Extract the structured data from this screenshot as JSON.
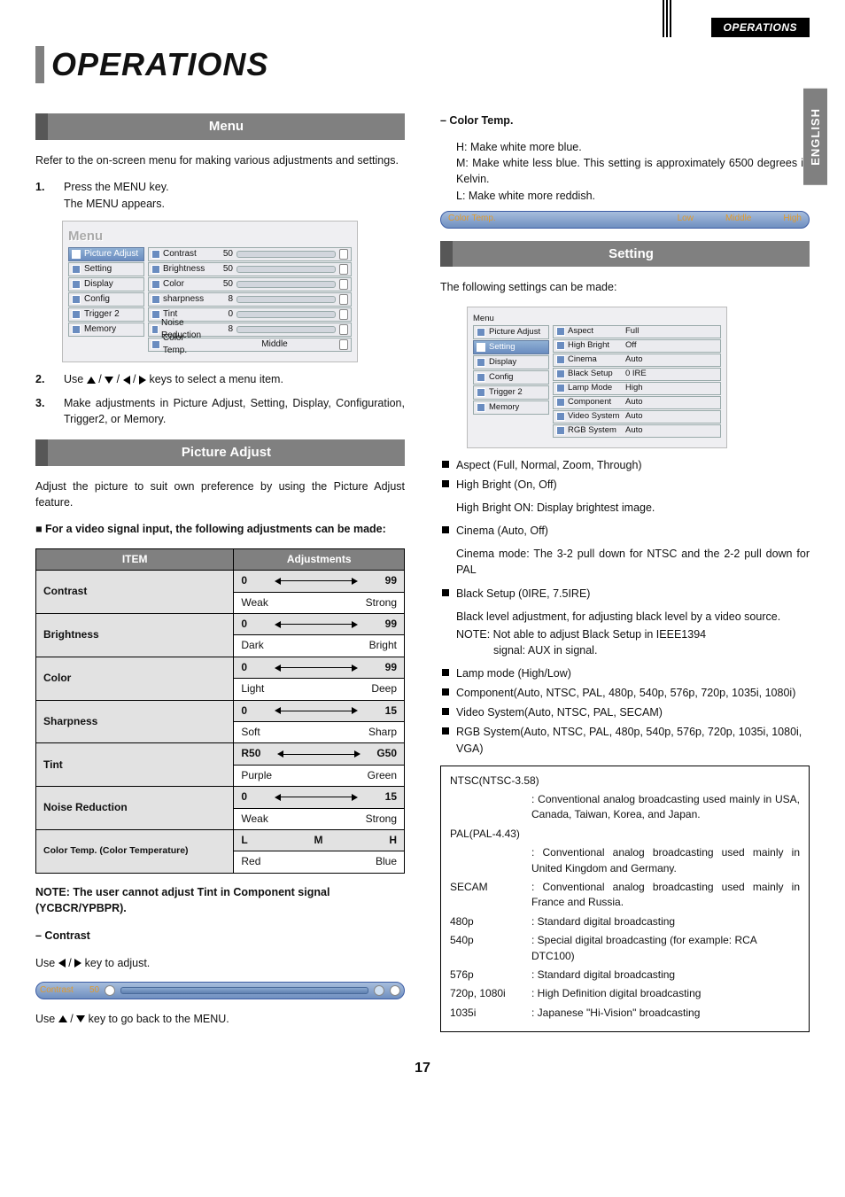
{
  "header": {
    "running_head": "OPERATIONS",
    "side_tab": "ENGLISH"
  },
  "title": "OPERATIONS",
  "left": {
    "menu_heading": "Menu",
    "intro": "Refer to the on-screen menu for making various adjustments and settings.",
    "step1": {
      "num": "1.",
      "text": "Press the MENU key.",
      "sub": "The MENU appears."
    },
    "menu1": {
      "word": "Menu",
      "left": [
        "Picture Adjust",
        "Setting",
        "Display",
        "Config",
        "Trigger 2",
        "Memory"
      ],
      "rows": [
        {
          "label": "Contrast",
          "v": "50",
          "fill": 50
        },
        {
          "label": "Brightness",
          "v": "50",
          "fill": 50
        },
        {
          "label": "Color",
          "v": "50",
          "fill": 50
        },
        {
          "label": "sharpness",
          "v": "8",
          "fill": 53
        },
        {
          "label": "Tint",
          "v": "0",
          "fill": 40
        },
        {
          "label": "Noise Reduction",
          "v": "8",
          "fill": 53
        },
        {
          "label": "Color Temp.",
          "v": "Middle",
          "bar": false
        }
      ]
    },
    "step2": {
      "num": "2.",
      "pre": "Use",
      "post": "keys to select a menu item."
    },
    "step3": {
      "num": "3.",
      "text": "Make adjustments in Picture Adjust, Setting, Display, Configuration, Trigger2, or Memory."
    },
    "pict_heading": "Picture Adjust",
    "pict_intro": "Adjust the picture to suit own preference by using the Picture Adjust feature.",
    "pict_bold": "For a video signal input, the following adjustments can be made:",
    "table": {
      "headers": {
        "item": "ITEM",
        "adj": "Adjustments"
      },
      "rows": [
        {
          "item": "Contrast",
          "lo": "0",
          "hi": "99",
          "llab": "Weak",
          "rlab": "Strong"
        },
        {
          "item": "Brightness",
          "lo": "0",
          "hi": "99",
          "llab": "Dark",
          "rlab": "Bright"
        },
        {
          "item": "Color",
          "lo": "0",
          "hi": "99",
          "llab": "Light",
          "rlab": "Deep"
        },
        {
          "item": "Sharpness",
          "lo": "0",
          "hi": "15",
          "llab": "Soft",
          "rlab": "Sharp"
        },
        {
          "item": "Tint",
          "lo": "R50",
          "hi": "G50",
          "llab": "Purple",
          "rlab": "Green"
        },
        {
          "item": "Noise Reduction",
          "lo": "0",
          "hi": "15",
          "llab": "Weak",
          "rlab": "Strong"
        },
        {
          "item": "Color Temp. (Color Temperature)",
          "ctL": "L",
          "ctM": "M",
          "ctH": "H",
          "llab": "Red",
          "rlab": "Blue"
        }
      ]
    },
    "note": "NOTE: The user cannot adjust Tint in Component signal (YCBCR/YPBPR).",
    "contrast_sub": "– Contrast",
    "contrast_use_pre": "Use",
    "contrast_use_post": "key to adjust.",
    "contrast_bar": {
      "label": "Contrast",
      "val": "50"
    },
    "back_pre": "Use",
    "back_post": "key to go back to the MENU."
  },
  "right": {
    "ct_heading": "– Color Temp.",
    "ct_H": "H:  Make white more blue.",
    "ct_M": "M: Make white less blue. This setting is approximately 6500 degrees in Kelvin.",
    "ct_L": "L:  Make white more reddish.",
    "ct_pill": {
      "label": "Color Temp.",
      "o1": "Low",
      "o2": "Middle",
      "o3": "High"
    },
    "setting_heading": "Setting",
    "setting_intro": "The following settings can be made:",
    "menu2": {
      "word": "Menu",
      "left": [
        "Picture Adjust",
        "Setting",
        "Display",
        "Config",
        "Trigger 2",
        "Memory"
      ],
      "rows": [
        {
          "label": "Aspect",
          "v": "Full"
        },
        {
          "label": "High Bright",
          "v": "Off"
        },
        {
          "label": "Cinema",
          "v": "Auto"
        },
        {
          "label": "Black Setup",
          "v": "0 IRE"
        },
        {
          "label": "Lamp Mode",
          "v": "High"
        },
        {
          "label": "Component",
          "v": "Auto"
        },
        {
          "label": "Video System",
          "v": "Auto"
        },
        {
          "label": "RGB System",
          "v": "Auto"
        }
      ]
    },
    "bullets": {
      "aspect": "Aspect (Full, Normal, Zoom, Through)",
      "hb": "High Bright (On, Off)",
      "hb_sub": "High Bright ON: Display brightest image.",
      "cinema": "Cinema (Auto, Off)",
      "cinema_sub": "Cinema mode: The 3-2 pull down for NTSC and the 2-2 pull down for PAL",
      "black": "Black Setup (0IRE, 7.5IRE)",
      "black_sub1": "Black level adjustment, for adjusting black level by a video source.",
      "black_sub2a": "NOTE: Not able to adjust Black Setup in IEEE1394",
      "black_sub2b": "signal: AUX in signal.",
      "lamp": "Lamp mode (High/Low)",
      "component": "Component(Auto, NTSC, PAL, 480p, 540p, 576p, 720p, 1035i, 1080i)",
      "video": "Video System(Auto, NTSC, PAL, SECAM)",
      "rgb": "RGB System(Auto, NTSC, PAL, 480p, 540p, 576p, 720p, 1035i, 1080i, VGA)"
    },
    "notebox": {
      "ntsc_k": "NTSC(NTSC-3.58)",
      "ntsc_v": ": Conventional analog broadcasting used mainly in USA, Canada, Taiwan, Korea, and Japan.",
      "pal_k": "PAL(PAL-4.43)",
      "pal_v": ": Conventional analog broadcasting used mainly in United Kingdom and Germany.",
      "secam_k": "SECAM",
      "secam_v": ": Conventional analog broadcasting used mainly in France and Russia.",
      "p480_k": "480p",
      "p480_v": ": Standard digital broadcasting",
      "p540_k": "540p",
      "p540_v": ": Special digital broadcasting (for example: RCA DTC100)",
      "p576_k": "576p",
      "p576_v": ": Standard digital broadcasting",
      "p720_k": "720p, 1080i",
      "p720_v": ": High Definition digital broadcasting",
      "p1035_k": "1035i",
      "p1035_v": ": Japanese \"Hi-Vision\" broadcasting"
    }
  },
  "page_number": "17"
}
